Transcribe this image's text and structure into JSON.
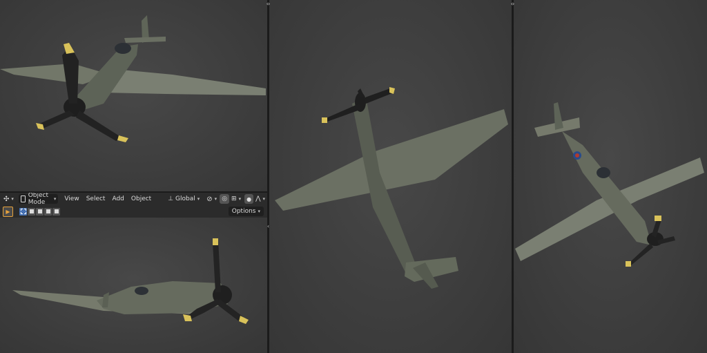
{
  "header": {
    "mode_label": "Object Mode",
    "menus": [
      "View",
      "Select",
      "Add",
      "Object"
    ],
    "transform_orientation": "Global",
    "options_label": "Options"
  },
  "colors": {
    "background": "#3d3d3d",
    "header": "#2b2b2b",
    "accent_selected": "#4772b3",
    "tool_active": "#e8a33c",
    "plane_body": "#6f7366",
    "propeller_tip": "#d9c25a"
  },
  "icons": {
    "editor_type": "transform-gizmo-icon",
    "mode": "object-mode-icon",
    "orientation": "orientation-icon",
    "pivot": "pivot-icon",
    "snap": "magnet-icon",
    "snap_target": "snap-increment-icon",
    "proportional": "proportional-edit-icon",
    "falloff": "falloff-curve-icon",
    "select_tool": "select-box-icon",
    "expand": "expand-arrows-icon"
  }
}
